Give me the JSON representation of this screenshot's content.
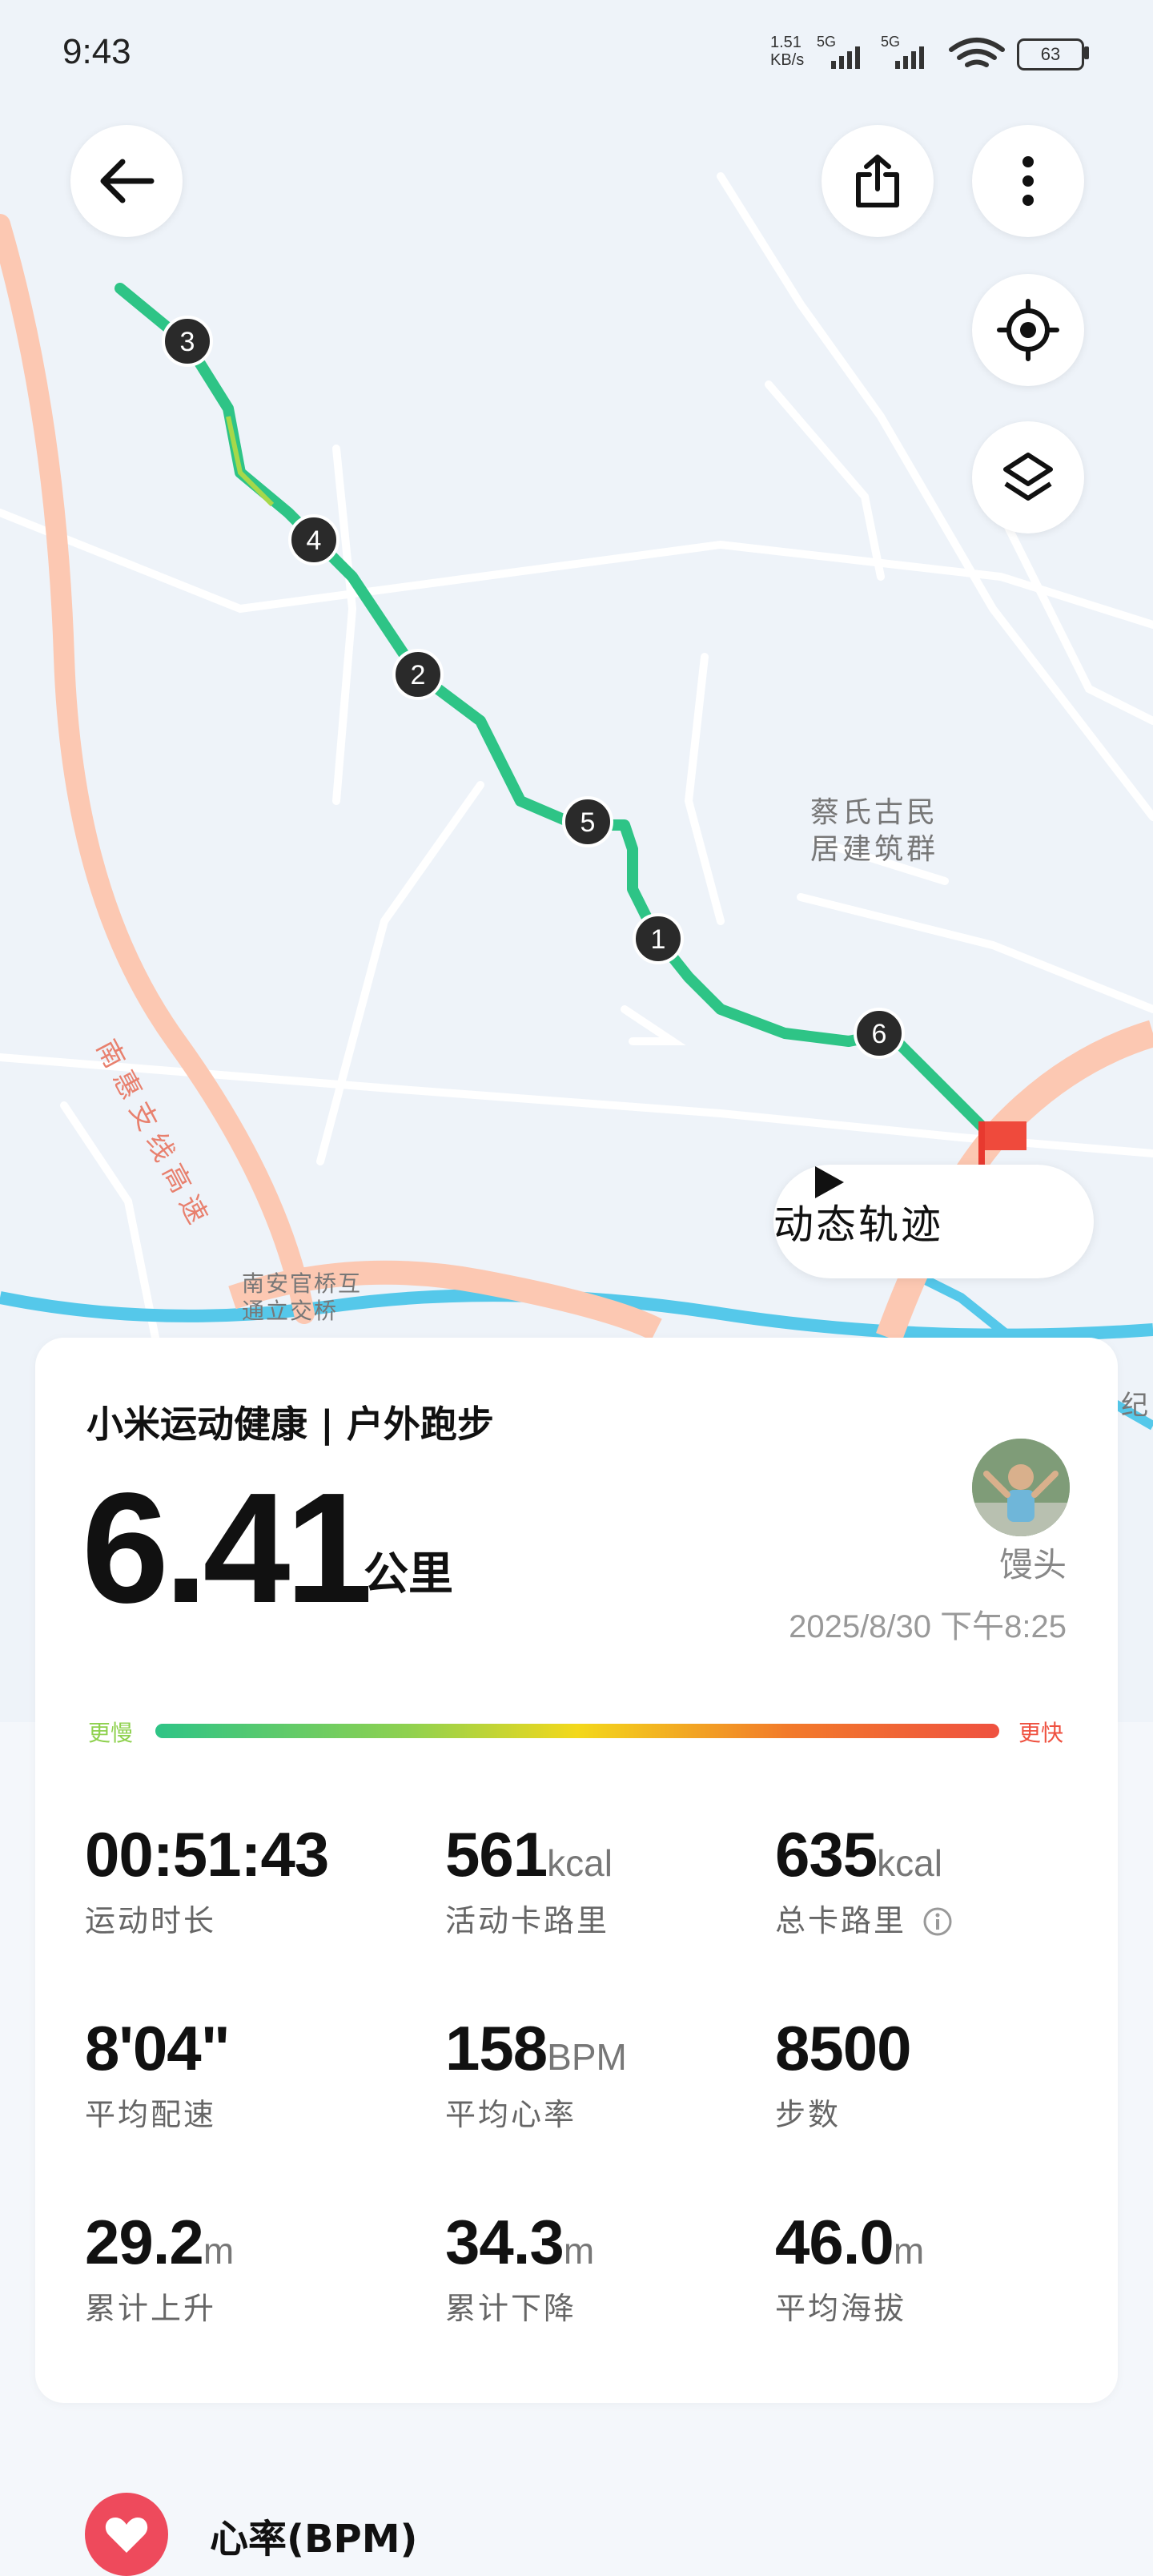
{
  "status_bar": {
    "time": "9:43",
    "net_speed_value": "1.51",
    "net_speed_unit": "KB/s",
    "signal_1_label": "5G",
    "signal_2_label": "5G",
    "battery": "63"
  },
  "map": {
    "labels": {
      "village": [
        "蔡氏古民",
        "居建筑群"
      ],
      "expressway": "南惠支线高速",
      "interchange": [
        "南安官桥互",
        "通立交桥"
      ],
      "edge_text": "纪"
    },
    "markers": [
      "1",
      "2",
      "3",
      "4",
      "5",
      "6"
    ],
    "playback_button_label": "动态轨迹",
    "route_color": "#2ec486"
  },
  "toolbar": {
    "back_icon": "arrow-left-icon",
    "share_icon": "share-icon",
    "more_icon": "more-vertical-icon",
    "locate_icon": "locate-icon",
    "layers_icon": "layers-icon"
  },
  "summary": {
    "title": "小米运动健康 | 户外跑步",
    "distance": "6.41",
    "distance_unit": "公里",
    "user_name": "馒头",
    "datetime": "2025/8/30 下午8:25",
    "pace_slow_label": "更慢",
    "pace_fast_label": "更快",
    "pace_slow_color": "#8fd14f",
    "pace_fast_color": "#ef5140"
  },
  "stats": [
    {
      "value": "00:51:43",
      "unit": "",
      "label": "运动时长"
    },
    {
      "value": "561",
      "unit": "kcal",
      "label": "活动卡路里"
    },
    {
      "value": "635",
      "unit": "kcal",
      "label": "总卡路里"
    },
    {
      "value": "8'04\"",
      "unit": "",
      "label": "平均配速"
    },
    {
      "value": "158",
      "unit": "BPM",
      "label": "平均心率"
    },
    {
      "value": "8500",
      "unit": "",
      "label": "步数"
    },
    {
      "value": "29.2",
      "unit": "m",
      "label": "累计上升"
    },
    {
      "value": "34.3",
      "unit": "m",
      "label": "累计下降"
    },
    {
      "value": "46.0",
      "unit": "m",
      "label": "平均海拔"
    }
  ],
  "heart_rate": {
    "title": "心率(BPM)",
    "icon": "heart-icon",
    "accent": "#ee4a5c"
  }
}
